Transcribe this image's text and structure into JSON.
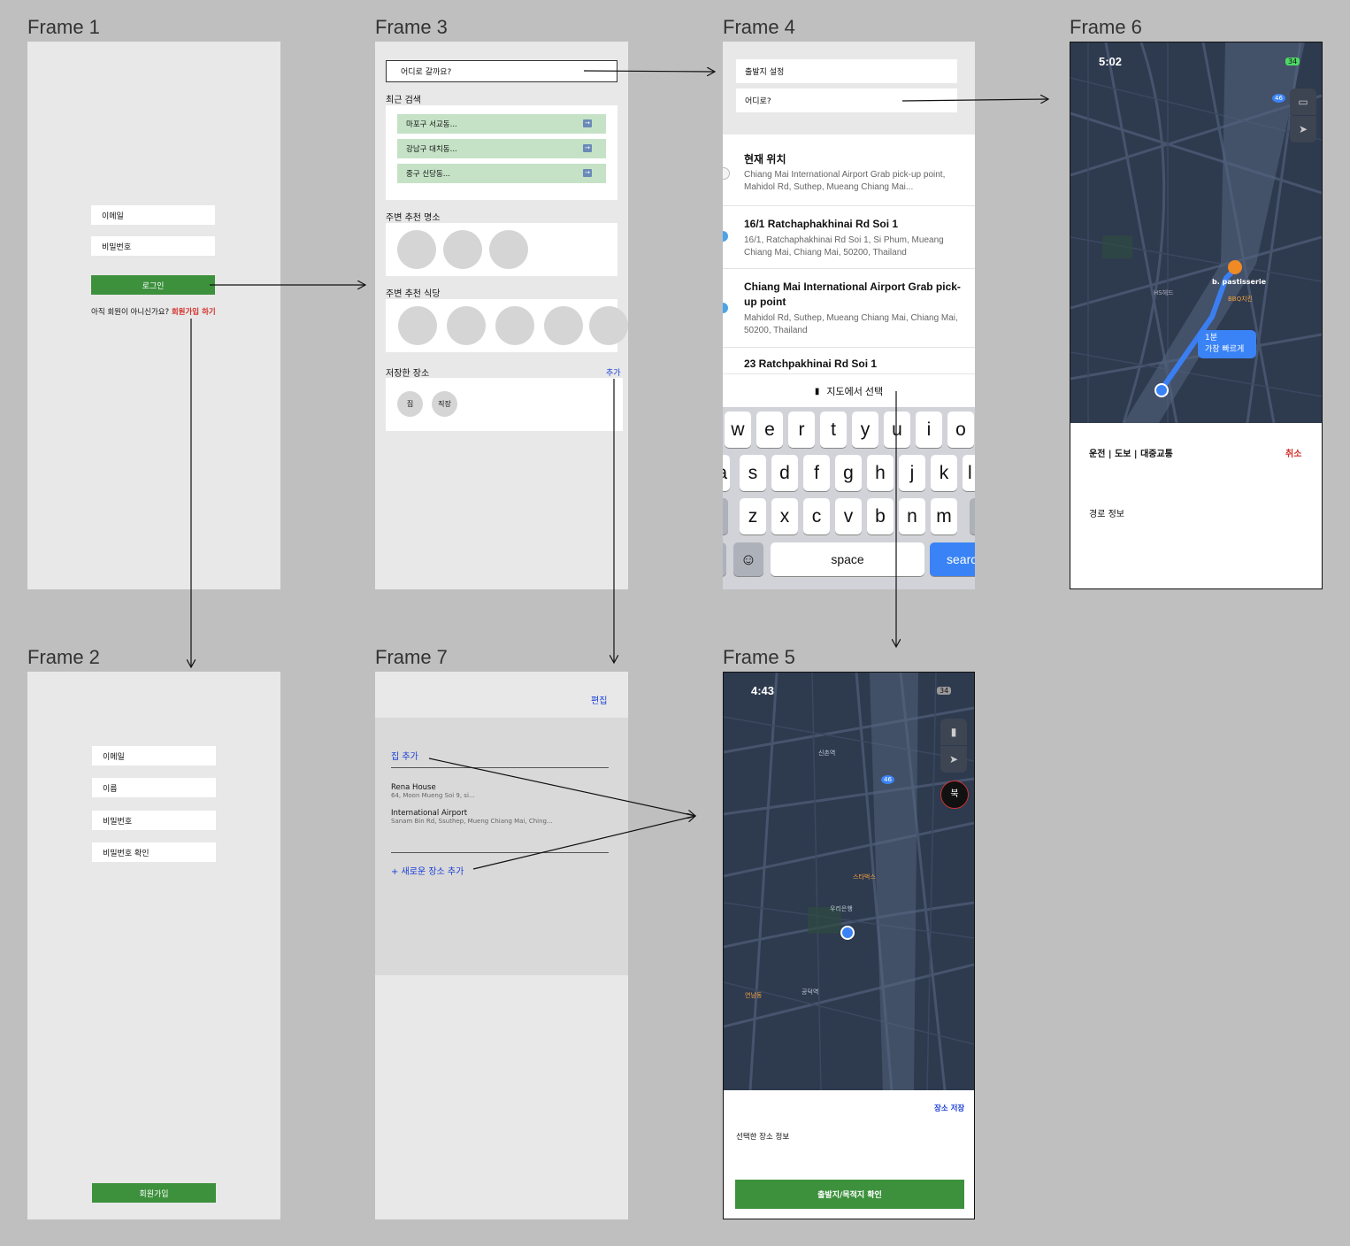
{
  "frames": {
    "f1": {
      "title": "Frame 1",
      "email": "이메일",
      "password": "비밀번호",
      "login": "로그인",
      "signup_prompt": "아직 회원이 아니신가요?",
      "signup_link": "회원가입 하기"
    },
    "f2": {
      "title": "Frame 2",
      "email": "이메일",
      "name": "이름",
      "password": "비밀번호",
      "password_confirm": "비밀번호 확인",
      "signup": "회원가입"
    },
    "f3": {
      "title": "Frame 3",
      "search_placeholder": "어디로 갈까요?",
      "recent_title": "최근 검색",
      "recent": [
        {
          "label": "마포구 서교동..."
        },
        {
          "label": "강남구 대치동..."
        },
        {
          "label": "중구 신당동..."
        }
      ],
      "places_title": "주변 추천 명소",
      "restaurants_title": "주변 추천 식당",
      "saved_title": "저장한 장소",
      "saved_add": "추가",
      "saved": [
        {
          "label": "집"
        },
        {
          "label": "직장"
        }
      ]
    },
    "f4": {
      "title": "Frame 4",
      "origin": "출발지 설정",
      "destination": "어디로?",
      "results": [
        {
          "name": "현재 위치",
          "addr": "Chiang Mai International Airport Grab pick-up point, Mahidol Rd, Suthep, Mueang Chiang Mai..."
        },
        {
          "name": "16/1 Ratchaphakhinai Rd Soi 1",
          "addr": "16/1, Ratchaphakhinai Rd Soi 1, Si Phum, Mueang Chiang Mai, Chiang Mai, 50200, Thailand"
        },
        {
          "name": "Chiang Mai International Airport Grab pick-up point",
          "addr": "Mahidol Rd, Suthep, Mueang Chiang Mai, Chiang Mai, 50200, Thailand"
        },
        {
          "name": "23 Ratchpakhinai Rd Soi 1",
          "addr": ""
        }
      ],
      "map_select": "지도에서 선택",
      "keyboard": {
        "row1": [
          "w",
          "e",
          "r",
          "t",
          "y",
          "u",
          "i",
          "o"
        ],
        "row2": [
          "a",
          "s",
          "d",
          "f",
          "g",
          "h",
          "j",
          "k",
          "l"
        ],
        "row3": [
          "z",
          "x",
          "c",
          "v",
          "b",
          "n",
          "m"
        ],
        "space": "space",
        "search": "search"
      }
    },
    "f5": {
      "title": "Frame 5",
      "time": "4:43",
      "battery": "34",
      "save_place": "장소 저장",
      "selected_info": "선택한 장소 정보",
      "confirm": "출발지/목적지 확인",
      "compass": "북",
      "map_labels": [
        "46",
        "신촌역",
        "스타벅스",
        "우리은행",
        "연남동",
        "공덕역"
      ]
    },
    "f6": {
      "title": "Frame 6",
      "time": "5:02",
      "battery": "34",
      "destination_label": "b. pastisserie",
      "route_badge_time": "1분",
      "route_badge_desc": "가장 빠르게",
      "modes": [
        {
          "label": "운전"
        },
        {
          "label": "도보"
        },
        {
          "label": "대중교통"
        }
      ],
      "cancel": "취소",
      "route_info": "경로 정보",
      "map_labels": [
        "46",
        "HS헤드",
        "BBQ치킨"
      ]
    },
    "f7": {
      "title": "Frame 7",
      "edit": "편집",
      "home_add": "집 추가",
      "places": [
        {
          "name": "Rena House",
          "addr": "64, Moon Mueng Soi 9, si..."
        },
        {
          "name": "International Airport",
          "addr": "Sanam Bin Rd, Ssuthep, Mueng Chiang Mai, Ching..."
        }
      ],
      "new_place": "+ 새로운 장소 추가"
    }
  },
  "colors": {
    "background": "#bfbfbf",
    "frame": "#e8e8e8",
    "green": "#3d913d",
    "recent_green": "#c5e2c6",
    "link_red": "#d2312a",
    "link_blue": "#1a3fd8",
    "map": "#2e3a4e",
    "ios_blue": "#3a83f6"
  }
}
